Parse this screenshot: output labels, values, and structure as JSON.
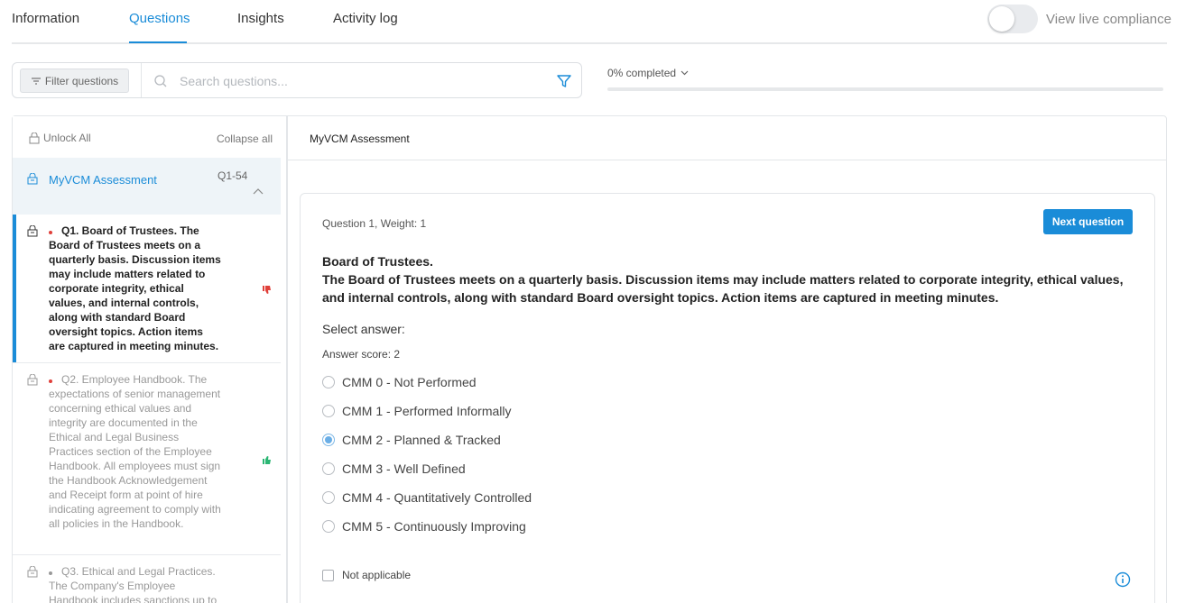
{
  "tabs": [
    {
      "label": "Information"
    },
    {
      "label": "Questions"
    },
    {
      "label": "Insights"
    },
    {
      "label": "Activity log"
    }
  ],
  "active_tab": "Questions",
  "live_compliance": {
    "label": "View live compliance",
    "enabled": false
  },
  "filter": {
    "button_label": "Filter questions",
    "search_placeholder": "Search questions...",
    "search_value": ""
  },
  "progress": {
    "label": "0% completed",
    "percent": 0
  },
  "sidebar": {
    "unlock_all": "Unlock All",
    "collapse_all": "Collapse all",
    "section": {
      "label": "MyVCM Assessment",
      "range": "Q1-54"
    },
    "questions": [
      {
        "text": "Q1. Board of Trustees. The Board of Trustees meets on a quarterly basis. Discussion items may include matters related to corporate integrity, ethical values, and internal controls, along with standard Board oversight topics. Action items are captured in meeting minutes.",
        "status": "thumbs-down-icon",
        "dot_color": "#e0403a",
        "status_color": "#e0403a"
      },
      {
        "text": "Q2. Employee Handbook. The expectations of senior management concerning ethical values and integrity are documented in the Ethical and Legal Business Practices section of the Employee Handbook. All employees must sign the Handbook Acknowledgement and Receipt form at point of hire indicating agreement to comply with all policies in the Handbook.",
        "status": "thumbs-up-icon",
        "dot_color": "#e0403a",
        "status_color": "#2bb673"
      },
      {
        "text": "Q3. Ethical and Legal Practices. The Company's Employee Handbook includes sanctions up to",
        "status": "",
        "dot_color": "#999999",
        "status_color": ""
      }
    ]
  },
  "pane": {
    "title": "MyVCM Assessment",
    "question_meta": "Question 1, Weight: 1",
    "next_button": "Next question",
    "question_title": "Board of Trustees.",
    "question_body": "The Board of Trustees meets on a quarterly basis. Discussion items may include matters related to corporate integrity, ethical values, and internal controls, along with standard Board oversight topics. Action items are captured in meeting minutes.",
    "select_answer": "Select answer:",
    "answer_score_label": "Answer score:",
    "answer_score_value": "2",
    "options": [
      {
        "label": "CMM 0 - Not Performed",
        "checked": false
      },
      {
        "label": "CMM 1 - Performed Informally",
        "checked": false
      },
      {
        "label": "CMM 2 - Planned & Tracked",
        "checked": true
      },
      {
        "label": "CMM 3 - Well Defined",
        "checked": false
      },
      {
        "label": "CMM 4 - Quantitatively Controlled",
        "checked": false
      },
      {
        "label": "CMM 5 - Continuously Improving",
        "checked": false
      }
    ],
    "not_applicable": "Not applicable"
  },
  "colors": {
    "accent": "#1a8cd8"
  }
}
